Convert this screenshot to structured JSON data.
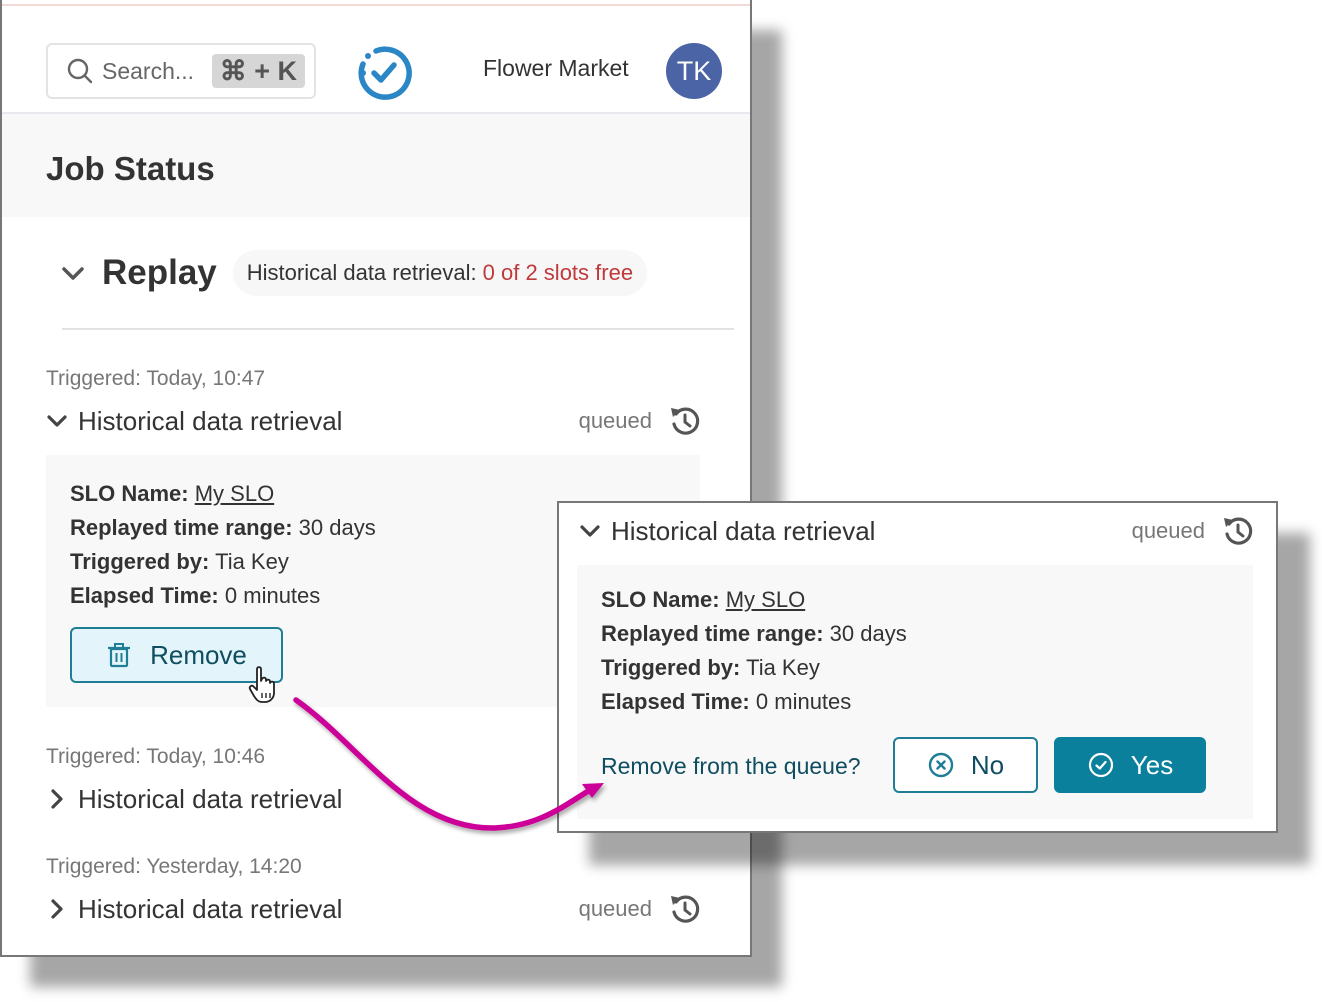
{
  "header": {
    "search_placeholder": "Search...",
    "search_shortcut": "⌘ + K",
    "org_name": "Flower Market",
    "avatar_initials": "TK"
  },
  "page": {
    "title": "Job Status"
  },
  "section": {
    "title": "Replay",
    "slots_label": "Historical data retrieval:",
    "slots_value": "0 of 2 slots free"
  },
  "jobs": [
    {
      "triggered": "Triggered: Today, 10:47",
      "title": "Historical data retrieval",
      "status": "queued",
      "expanded": true,
      "details": {
        "slo_name_label": "SLO Name:",
        "slo_name": "My SLO",
        "range_label": "Replayed time range:",
        "range": "30 days",
        "triggered_by_label": "Triggered by:",
        "triggered_by": "Tia Key",
        "elapsed_label": "Elapsed Time:",
        "elapsed": "0 minutes"
      },
      "remove_label": "Remove"
    },
    {
      "triggered": "Triggered: Today, 10:46",
      "title": "Historical data retrieval",
      "expanded": false
    },
    {
      "triggered": "Triggered: Yesterday, 14:20",
      "title": "Historical data retrieval",
      "status": "queued",
      "expanded": false
    }
  ],
  "popup": {
    "title": "Historical data retrieval",
    "status": "queued",
    "details": {
      "slo_name_label": "SLO Name:",
      "slo_name": "My SLO",
      "range_label": "Replayed time range:",
      "range": "30 days",
      "triggered_by_label": "Triggered by:",
      "triggered_by": "Tia Key",
      "elapsed_label": "Elapsed Time:",
      "elapsed": "0 minutes"
    },
    "confirm_question": "Remove from the queue?",
    "no_label": "No",
    "yes_label": "Yes"
  },
  "colors": {
    "brand_blue": "#2a86c4",
    "avatar": "#4b64a6",
    "slots_red": "#c0393b",
    "primary_teal": "#0b809d",
    "annotation_magenta": "#cc0099"
  }
}
